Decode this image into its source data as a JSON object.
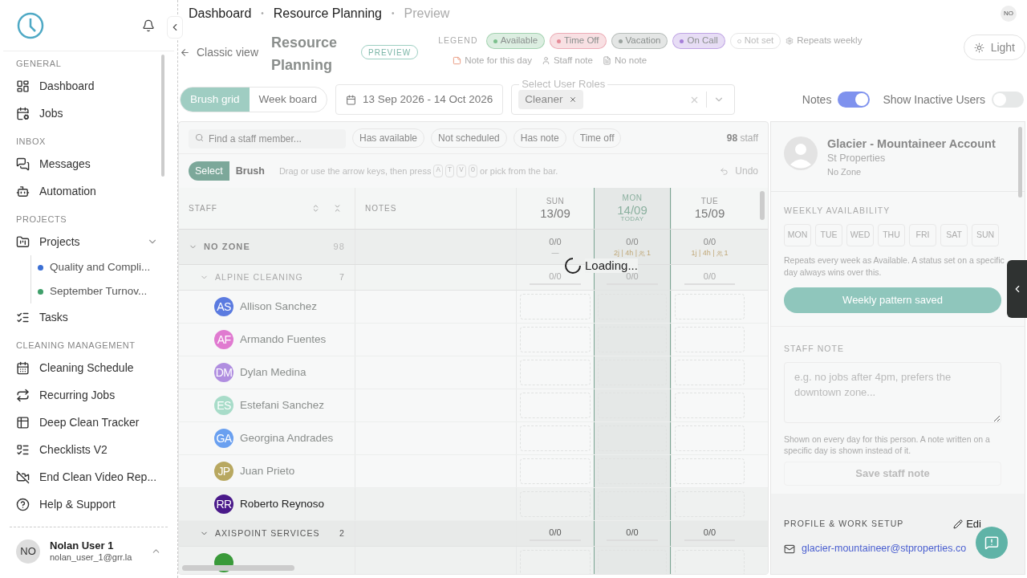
{
  "breadcrumbs": [
    {
      "label": "Dashboard",
      "current": false
    },
    {
      "label": "Resource Planning",
      "current": false
    },
    {
      "label": "Preview",
      "current": true
    }
  ],
  "breadcrumb_separator": "•",
  "account": {
    "initials": "NO"
  },
  "back_link": "Classic view",
  "page_title": "Resource Planning",
  "badge": "PREVIEW",
  "legend": {
    "title": "LEGEND",
    "statuses": [
      {
        "kind": "pill",
        "label": "Available",
        "color": "#7cc08d"
      },
      {
        "kind": "pill",
        "label": "Time Off",
        "color": "#e58a97"
      },
      {
        "kind": "pill",
        "label": "Vacation",
        "color": "#9aa29e"
      },
      {
        "kind": "pill",
        "label": "On Call",
        "color": "#a57fd8"
      },
      {
        "kind": "outline",
        "label": "Not set"
      },
      {
        "kind": "plain",
        "label": "Repeats weekly"
      }
    ],
    "notes": [
      {
        "kind": "day",
        "label": "Note for this day"
      },
      {
        "kind": "staff",
        "label": "Staff note"
      },
      {
        "kind": "none",
        "label": "No note"
      }
    ]
  },
  "theme_button": "Light",
  "views": [
    {
      "label": "Brush grid",
      "selected": true
    },
    {
      "label": "Week board",
      "selected": false
    }
  ],
  "date_range": "13 Sep 2026 - 14 Oct 2026",
  "roles": {
    "label": "Select User Roles",
    "chips": [
      "Cleaner"
    ]
  },
  "toggles": [
    {
      "label": "Notes",
      "on": true
    },
    {
      "label": "Show Inactive Users",
      "on": false
    }
  ],
  "search": {
    "placeholder": "Find a staff member..."
  },
  "filters": [
    "Has available",
    "Not scheduled",
    "Has note",
    "Time off"
  ],
  "staff_count": {
    "number": "98",
    "unit": "staff"
  },
  "modes": [
    {
      "label": "Select",
      "selected": true
    },
    {
      "label": "Brush",
      "selected": false
    }
  ],
  "hint": {
    "before": "Drag or use the arrow keys, then press",
    "keys": [
      "A",
      "T",
      "V",
      "O"
    ],
    "after": "or pick from the bar."
  },
  "undo": "Undo",
  "columns": {
    "staff": "STAFF",
    "notes": "NOTES"
  },
  "days": [
    {
      "weekday": "SUN",
      "date": "13/09",
      "selected": false
    },
    {
      "weekday": "MON",
      "date": "14/09",
      "today": "TODAY",
      "selected": true
    },
    {
      "weekday": "TUE",
      "date": "15/09",
      "selected": false
    }
  ],
  "zone": {
    "name": "NO ZONE",
    "count": "98",
    "expanded": true,
    "cells": [
      {
        "ratio": "0/0",
        "detail": "—"
      },
      {
        "ratio": "0/0",
        "summary": "2j | 4h |",
        "people": "1"
      },
      {
        "ratio": "0/0",
        "summary": "1j | 4h |",
        "people": "1"
      }
    ]
  },
  "groups": [
    {
      "name": "ALPINE CLEANING",
      "count": "7",
      "expanded": true,
      "dimmed": true,
      "cells": [
        "0/0",
        "0/0",
        "0/0"
      ],
      "members": [
        {
          "initials": "AS",
          "name": "Allison Sanchez",
          "color": "#5b7be0",
          "dimmed": true
        },
        {
          "initials": "AF",
          "name": "Armando Fuentes",
          "color": "#e07ad0",
          "dimmed": true
        },
        {
          "initials": "DM",
          "name": "Dylan Medina",
          "color": "#b08ee0",
          "dimmed": true
        },
        {
          "initials": "ES",
          "name": "Estefani Sanchez",
          "color": "#a8dcc9",
          "dimmed": true
        },
        {
          "initials": "GA",
          "name": "Georgina Andrades",
          "color": "#6aa0f0",
          "dimmed": true
        },
        {
          "initials": "JP",
          "name": "Juan Prieto",
          "color": "#b8a860",
          "dimmed": true
        },
        {
          "initials": "RR",
          "name": "Roberto Reynoso",
          "color": "#4a1a8a",
          "dimmed": false
        }
      ]
    },
    {
      "name": "AXISPOINT SERVICES",
      "count": "2",
      "expanded": true,
      "dimmed": false,
      "cells": [
        "0/0",
        "0/0",
        "0/0"
      ],
      "members": [
        {
          "color": "#3a9a3a"
        }
      ]
    }
  ],
  "loading": "Loading...",
  "profile": {
    "name": "Glacier - Mountaineer Account",
    "company": "St Properties",
    "zone": "No Zone"
  },
  "weekly": {
    "title": "WEEKLY AVAILABILITY",
    "days": [
      "MON",
      "TUE",
      "WED",
      "THU",
      "FRI",
      "SAT",
      "SUN"
    ],
    "help": "Repeats every week as Available. A status set on a specific day always wins over this.",
    "button": "Weekly pattern saved"
  },
  "staff_note": {
    "title": "STAFF NOTE",
    "placeholder": "e.g. no jobs after 4pm, prefers the downtown zone...",
    "help": "Shown on every day for this person. A note written on a specific day is shown instead of it.",
    "button": "Save staff note"
  },
  "setup": {
    "title": "PROFILE & WORK SETUP",
    "edit": "Edi",
    "email": "glacier-mountaineer@stproperties.co"
  },
  "sidebar": {
    "sections": [
      {
        "title": "GENERAL",
        "items": [
          {
            "label": "Dashboard"
          },
          {
            "label": "Jobs"
          }
        ]
      },
      {
        "title": "INBOX",
        "items": [
          {
            "label": "Messages"
          },
          {
            "label": "Automation"
          }
        ]
      },
      {
        "title": "PROJECTS",
        "items": [
          {
            "label": "Projects",
            "expanded": true,
            "children": [
              {
                "label": "Quality and Compli...",
                "color": "#3b6fd4"
              },
              {
                "label": "September Turnov...",
                "color": "#3f9f6a"
              }
            ]
          },
          {
            "label": "Tasks"
          }
        ]
      },
      {
        "title": "CLEANING MANAGEMENT",
        "items": [
          {
            "label": "Cleaning Schedule"
          },
          {
            "label": "Recurring Jobs"
          },
          {
            "label": "Deep Clean Tracker"
          },
          {
            "label": "Checklists V2"
          },
          {
            "label": "End Clean Video Rep..."
          },
          {
            "label": "Help & Support"
          }
        ]
      }
    ],
    "user": {
      "initials": "NO",
      "name": "Nolan User 1",
      "email": "nolan_user_1@grr.la"
    }
  }
}
